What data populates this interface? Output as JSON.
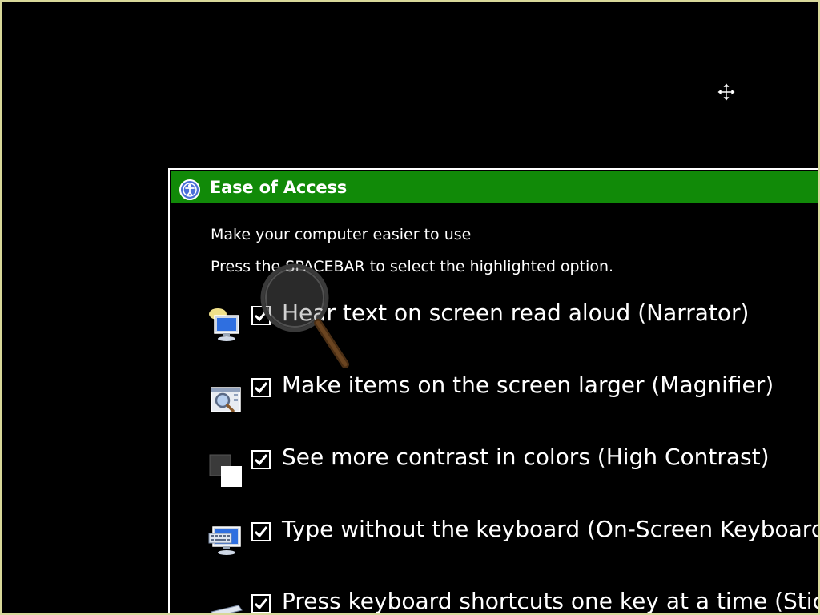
{
  "dialog": {
    "title": "Ease of Access",
    "instruction_1": "Make your computer easier to use",
    "instruction_2": "Press the SPACEBAR to select the highlighted option."
  },
  "options": [
    {
      "label": "Hear text on screen read aloud (Narrator)",
      "checked": true,
      "icon": "narrator-icon"
    },
    {
      "label": "Make items on the screen larger (Magnifier)",
      "checked": true,
      "icon": "magnifier-icon"
    },
    {
      "label": "See more contrast in colors (High Contrast)",
      "checked": true,
      "icon": "high-contrast-icon"
    },
    {
      "label": "Type without the keyboard (On-Screen Keyboard",
      "checked": true,
      "icon": "on-screen-keyboard-icon"
    },
    {
      "label": "Press keyboard shortcuts one key at a time (Stick",
      "checked": true,
      "icon": "sticky-keys-icon"
    }
  ],
  "colors": {
    "titlebar": "#118a08",
    "background": "#000000",
    "text": "#ffffff",
    "screen_border": "#d8d89a"
  }
}
